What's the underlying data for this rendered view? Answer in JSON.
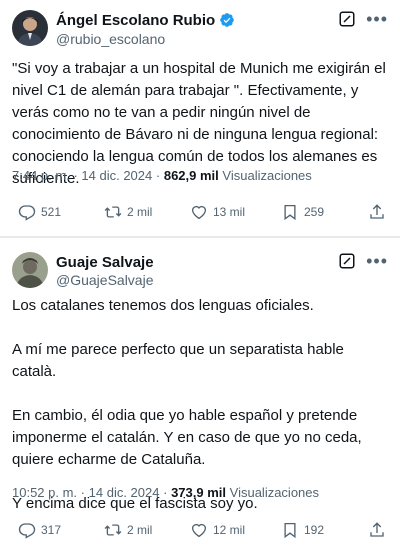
{
  "tweets": [
    {
      "author_name": "Ángel Escolano Rubio",
      "handle": "@rubio_escolano",
      "verified": true,
      "text": "\"Si voy a trabajar a un hospital de Munich me exigirán el nivel C1 de alemán para trabajar \". Efectivamente, y verás como no te van a pedir ningún nivel de conocimiento de Bávaro ni de ninguna lengua regional: conociendo la lengua común de todos los alemanes es suficiente.",
      "time": "7:44 p. m.",
      "date": "14 dic. 2024",
      "views": "862,9 mil",
      "views_label": "Visualizaciones",
      "replies": "521",
      "reposts": "2 mil",
      "likes": "13 mil",
      "bookmarks": "259"
    },
    {
      "author_name": "Guaje Salvaje",
      "handle": "@GuajeSalvaje",
      "verified": false,
      "paragraphs": [
        "Los catalanes tenemos dos lenguas oficiales.",
        "A mí me parece perfecto que un separatista hable català.",
        "En cambio, él odia que yo hable español y pretende imponerme el catalán. Y en caso de que yo no ceda, quiere echarme de Cataluña.",
        "Y encima dice que el fascista soy yo."
      ],
      "time": "10:52 p. m.",
      "date": "14 dic. 2024",
      "views": "373,9 mil",
      "views_label": "Visualizaciones",
      "replies": "317",
      "reposts": "2 mil",
      "likes": "12 mil",
      "bookmarks": "192"
    }
  ],
  "separator": "·",
  "colors": {
    "text": "#0f1419",
    "secondary": "#536471",
    "verified": "#1d9bf0",
    "divider": "#e7e9ea"
  }
}
